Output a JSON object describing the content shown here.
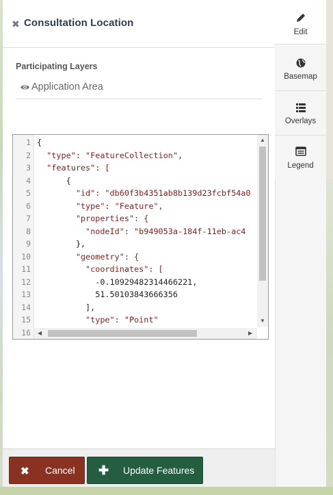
{
  "panel": {
    "title": "Consultation Location",
    "participating_layers_label": "Participating Layers",
    "layers": [
      {
        "name": "Application Area",
        "icon": "eye-icon"
      }
    ]
  },
  "editor": {
    "line_numbers": [
      "1",
      "2",
      "3",
      "4",
      "5",
      "6",
      "7",
      "8",
      "9",
      "10",
      "11",
      "12",
      "13",
      "14",
      "15",
      "16"
    ],
    "lines": [
      "{",
      "  \"type\": \"FeatureCollection\",",
      "  \"features\": [",
      "      {",
      "        \"id\": \"db60f3b4351ab8b139d23fcbf54a0",
      "        \"type\": \"Feature\",",
      "        \"properties\": {",
      "          \"nodeId\": \"b949053a-184f-11eb-ac4",
      "        },",
      "        \"geometry\": {",
      "          \"coordinates\": [",
      "            -0.10929482314466221,",
      "            51.50103843666356",
      "          ],",
      "          \"type\": \"Point\"",
      ""
    ]
  },
  "footer": {
    "cancel_label": "Cancel",
    "update_label": "Update Features"
  },
  "sidebar": {
    "tabs": [
      {
        "label": "Edit",
        "icon": "pencil-icon",
        "active": true
      },
      {
        "label": "Basemap",
        "icon": "globe-icon",
        "active": false
      },
      {
        "label": "Overlays",
        "icon": "list-icon",
        "active": false
      },
      {
        "label": "Legend",
        "icon": "legend-icon",
        "active": false
      }
    ]
  },
  "colors": {
    "cancel": "#8a3222",
    "update": "#245d40",
    "title": "#2d3d4e"
  }
}
